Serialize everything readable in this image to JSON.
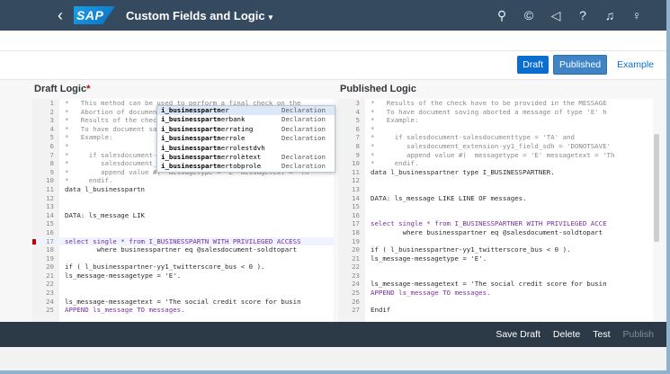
{
  "shell": {
    "back_icon": "chevron-left-icon",
    "logo_text": "SAP",
    "title": "Custom Fields and Logic",
    "title_caret": "▾",
    "icons": [
      "search-icon",
      "co-pilot-icon",
      "megaphone-icon",
      "help-icon",
      "bell-icon",
      "user-icon"
    ],
    "icon_glyphs": [
      "⚲",
      "©",
      "◁",
      "?",
      "♫",
      "♀"
    ]
  },
  "toolbar": {
    "draft_label": "Draft",
    "published_label": "Published",
    "example_label": "Example"
  },
  "left_pane": {
    "title": "Draft Logic",
    "required_mark": "*",
    "lines": [
      {
        "n": "1",
        "t": "*   This method can be used to perform a final check on the",
        "c": "cm"
      },
      {
        "n": "2",
        "t": "*   Abortion of document saving can be triggered, if necess",
        "c": "cm"
      },
      {
        "n": "3",
        "t": "*   Results of the check have to be provided in the MESSAGE",
        "c": "cm"
      },
      {
        "n": "4",
        "t": "*   To have document saving aborted a message of type 'E' h",
        "c": "cm"
      },
      {
        "n": "5",
        "t": "*   Example:",
        "c": "cm"
      },
      {
        "n": "6",
        "t": "*",
        "c": "cm"
      },
      {
        "n": "7",
        "t": "*     if salesdocument-salesdocumenttype = 'TA' and",
        "c": "cm"
      },
      {
        "n": "8",
        "t": "*        salesdocument_extension-yy1_field_sdh = 'DONOTSAVE'",
        "c": "cm"
      },
      {
        "n": "9",
        "t": "*        append value #(  messagetype = 'E' messagetext = 'Th",
        "c": "cm"
      },
      {
        "n": "10",
        "t": "*     endif.",
        "c": "cm"
      },
      {
        "n": "11",
        "t": "data l_businesspartn",
        "c": ""
      },
      {
        "n": "12",
        "t": "",
        "c": ""
      },
      {
        "n": "13",
        "t": "",
        "c": ""
      },
      {
        "n": "14",
        "t": "DATA: ls_message LIK",
        "c": ""
      },
      {
        "n": "15",
        "t": "",
        "c": ""
      },
      {
        "n": "16",
        "t": "",
        "c": ""
      },
      {
        "n": "17",
        "t": "select single * from I_BUSINESSPARTN WITH PRIVILEGED ACCESS",
        "c": "kw"
      },
      {
        "n": "18",
        "t": "        where businesspartner eq @salesdocument-soldtopart",
        "c": ""
      },
      {
        "n": "19",
        "t": "",
        "c": ""
      },
      {
        "n": "20",
        "t": "if ( l_businesspartner-yy1_twitterscore_bus < 0 ).",
        "c": ""
      },
      {
        "n": "21",
        "t": "ls_message-messagetype = 'E'.",
        "c": ""
      },
      {
        "n": "22",
        "t": "",
        "c": ""
      },
      {
        "n": "23",
        "t": "",
        "c": ""
      },
      {
        "n": "24",
        "t": "ls_message-messagetext = 'The social credit score for busin",
        "c": ""
      },
      {
        "n": "25",
        "t": "APPEND ls_message TO messages.",
        "c": "kw"
      }
    ]
  },
  "autocomplete": {
    "items": [
      {
        "prefix": "i_businesspartn",
        "rest": "er",
        "kind": "Declaration"
      },
      {
        "prefix": "i_businesspartn",
        "rest": "erbank",
        "kind": "Declaration"
      },
      {
        "prefix": "i_businesspartn",
        "rest": "errating",
        "kind": "Declaration"
      },
      {
        "prefix": "i_businesspartn",
        "rest": "errole",
        "kind": "Declaration"
      },
      {
        "prefix": "i_businesspartn",
        "rest": "errolestdvh",
        "kind": ""
      },
      {
        "prefix": "i_businesspartn",
        "rest": "errolètext",
        "kind": "Declaration"
      },
      {
        "prefix": "i_businesspartn",
        "rest": "ertobprole",
        "kind": "Declaration"
      }
    ]
  },
  "right_pane": {
    "title": "Published Logic",
    "lines": [
      {
        "n": "3",
        "t": "*   Results of the check have to be provided in the MESSAGE",
        "c": "cm"
      },
      {
        "n": "4",
        "t": "*   To have document saving aborted a message of type 'E' h",
        "c": "cm"
      },
      {
        "n": "5",
        "t": "*   Example:",
        "c": "cm"
      },
      {
        "n": "6",
        "t": "*",
        "c": "cm"
      },
      {
        "n": "7",
        "t": "*     if salesdocument-salesdocumenttype = 'TA' and",
        "c": "cm"
      },
      {
        "n": "8",
        "t": "*        salesdocument_extension-yy1_field_sdh = 'DONOTSAVE'",
        "c": "cm"
      },
      {
        "n": "9",
        "t": "*        append value #(  messagetype = 'E' messagetext = 'Th",
        "c": "cm"
      },
      {
        "n": "10",
        "t": "*     endif.",
        "c": "cm"
      },
      {
        "n": "11",
        "t": "data l_businesspartner type I_BUSINESSPARTNER.",
        "c": ""
      },
      {
        "n": "12",
        "t": "",
        "c": ""
      },
      {
        "n": "13",
        "t": "",
        "c": ""
      },
      {
        "n": "14",
        "t": "DATA: ls_message LIKE LINE OF messages.",
        "c": ""
      },
      {
        "n": "15",
        "t": "",
        "c": ""
      },
      {
        "n": "16",
        "t": "",
        "c": ""
      },
      {
        "n": "17",
        "t": "select single * from I_BUSINESSPARTNER WITH PRIVILEGED ACCE",
        "c": "kw"
      },
      {
        "n": "18",
        "t": "        where businesspartner eq @salesdocument-soldtopart",
        "c": ""
      },
      {
        "n": "19",
        "t": "",
        "c": ""
      },
      {
        "n": "20",
        "t": "if ( l_businesspartner-yy1_twitterscore_bus < 0 ).",
        "c": ""
      },
      {
        "n": "21",
        "t": "ls_message-messagetype = 'E'.",
        "c": ""
      },
      {
        "n": "22",
        "t": "",
        "c": ""
      },
      {
        "n": "23",
        "t": "",
        "c": ""
      },
      {
        "n": "24",
        "t": "ls_message-messagetext = 'The social credit score for busin",
        "c": ""
      },
      {
        "n": "25",
        "t": "APPEND ls_message TO messages.",
        "c": "kw"
      },
      {
        "n": "26",
        "t": "",
        "c": ""
      },
      {
        "n": "27",
        "t": "Endif",
        "c": ""
      }
    ]
  },
  "footer": {
    "save_draft_label": "Save Draft",
    "delete_label": "Delete",
    "test_label": "Test",
    "publish_label": "Publish"
  }
}
